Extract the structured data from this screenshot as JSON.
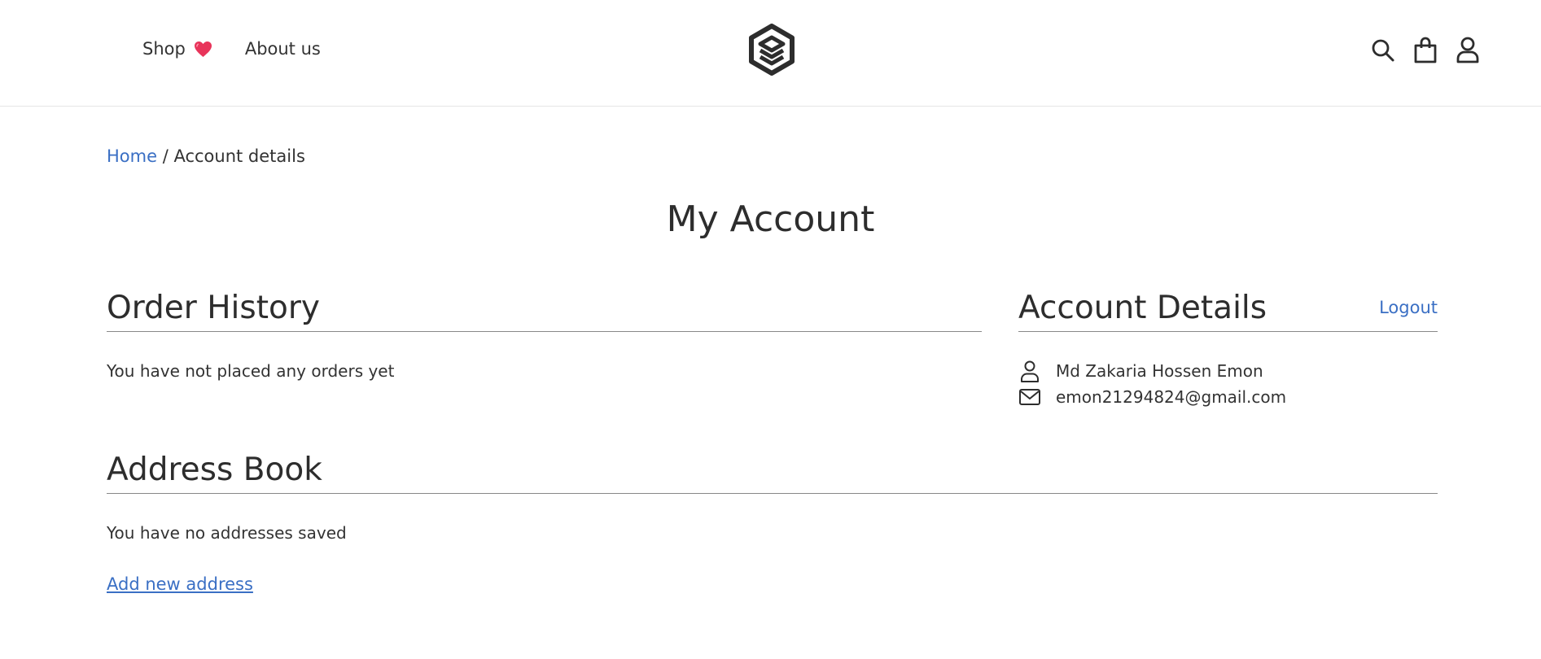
{
  "header": {
    "nav": [
      {
        "label": "Shop",
        "icon": "heart-icon",
        "icon_color": "#e8345a"
      },
      {
        "label": "About us"
      }
    ],
    "logo": "layers-logo-icon",
    "icons": [
      "search-icon",
      "shopping-bag-icon",
      "user-icon"
    ]
  },
  "breadcrumb": {
    "home": "Home",
    "separator": " / ",
    "current": "Account details"
  },
  "page_title": "My Account",
  "order_history": {
    "heading": "Order History",
    "empty_text": "You have not placed any orders yet"
  },
  "account_details": {
    "heading": "Account Details",
    "logout_label": "Logout",
    "name": "Md Zakaria Hossen Emon",
    "email": "emon21294824@gmail.com",
    "name_icon": "user-icon",
    "email_icon": "mail-icon"
  },
  "address_book": {
    "heading": "Address Book",
    "empty_text": "You have no addresses saved",
    "add_label": "Add new address"
  },
  "colors": {
    "link": "#3a6fc4",
    "text": "#2d2d2d",
    "heart": "#e8345a",
    "divider": "#888888"
  }
}
